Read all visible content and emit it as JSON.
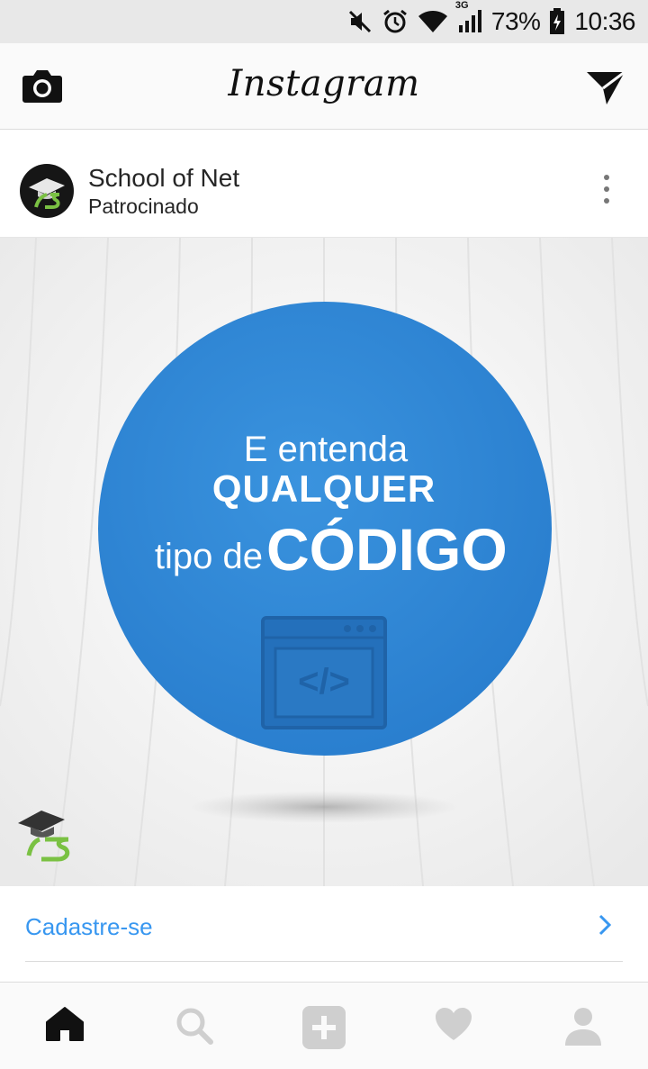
{
  "status_bar": {
    "network": "3G",
    "battery": "73%",
    "time": "10:36",
    "icons": [
      "mute-icon",
      "alarm-icon",
      "wifi-icon",
      "signal-icon",
      "battery-icon"
    ]
  },
  "top_bar": {
    "app_title": "Instagram",
    "left_icon": "camera-icon",
    "right_icon": "direct-message-icon"
  },
  "post": {
    "username": "School of Net",
    "subtitle": "Patrocinado",
    "image_text": {
      "line1": "E entenda",
      "line2": "QUALQUER",
      "line3_small": "tipo de",
      "line3_big": "CÓDIGO",
      "code_symbol": "</>"
    },
    "cta_label": "Cadastre-se"
  },
  "tabs": [
    {
      "name": "home",
      "icon": "home-icon",
      "active": true
    },
    {
      "name": "search",
      "icon": "search-icon",
      "active": false
    },
    {
      "name": "add",
      "icon": "add-post-icon",
      "active": false
    },
    {
      "name": "activity",
      "icon": "heart-icon",
      "active": false
    },
    {
      "name": "profile",
      "icon": "profile-icon",
      "active": false
    }
  ],
  "colors": {
    "link_blue": "#3897f0",
    "circle_blue": "#2f86d6",
    "brand_green": "#7ac143"
  }
}
